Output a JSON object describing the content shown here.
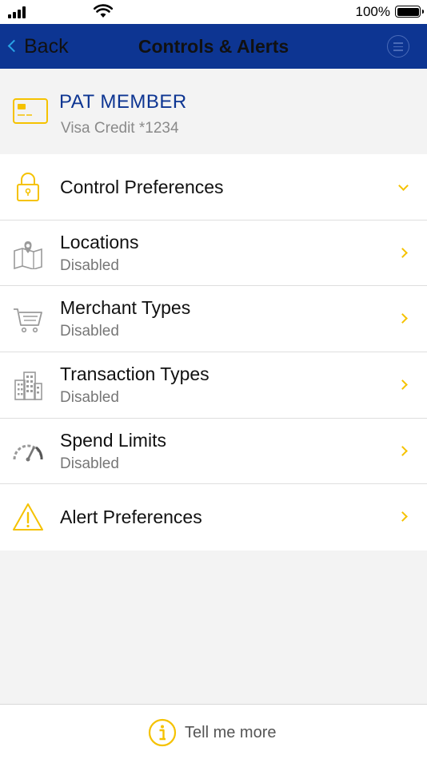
{
  "status_bar": {
    "battery_percent": "100%"
  },
  "nav": {
    "back_label": "Back",
    "title": "Controls & Alerts"
  },
  "card": {
    "name": "PAT MEMBER",
    "description": "Visa Credit *1234"
  },
  "list": {
    "control_preferences": {
      "label": "Control Preferences"
    },
    "locations": {
      "label": "Locations",
      "status": "Disabled"
    },
    "merchant_types": {
      "label": "Merchant Types",
      "status": "Disabled"
    },
    "transaction_types": {
      "label": "Transaction Types",
      "status": "Disabled"
    },
    "spend_limits": {
      "label": "Spend Limits",
      "status": "Disabled"
    },
    "alert_preferences": {
      "label": "Alert Preferences"
    }
  },
  "footer": {
    "tell_me_more_label": "Tell me more"
  },
  "colors": {
    "nav_blue": "#0d3592",
    "accent_yellow": "#f5c200",
    "icon_gray": "#9a9a9a",
    "back_chevron_blue": "#29a3e6"
  },
  "icons": [
    "cellular-signal-icon",
    "wifi-icon",
    "battery-icon",
    "back-chevron-icon",
    "menu-icon",
    "credit-card-icon",
    "lock-icon",
    "map-pin-icon",
    "shopping-cart-icon",
    "buildings-icon",
    "speedometer-icon",
    "warning-icon",
    "info-icon",
    "chevron-down-icon",
    "chevron-right-icon"
  ]
}
